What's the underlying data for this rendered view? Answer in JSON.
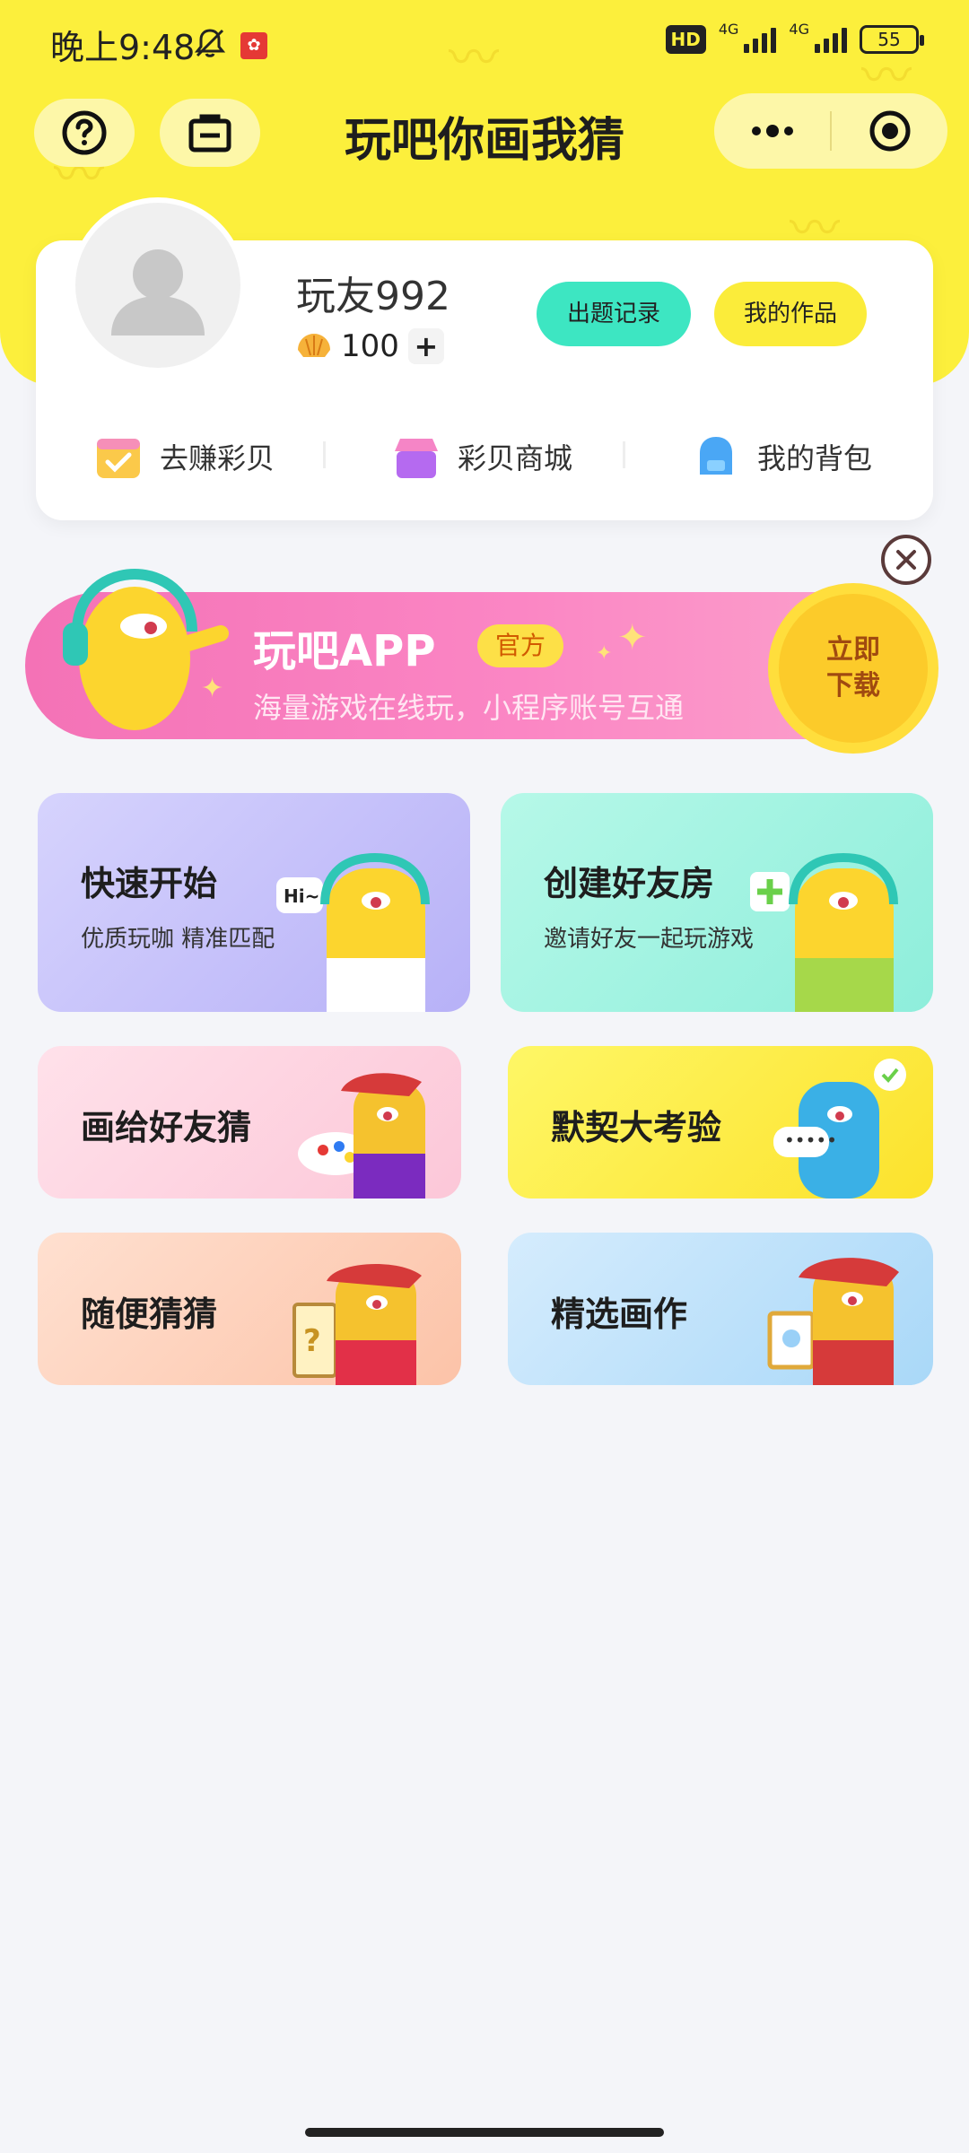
{
  "status_bar": {
    "time": "晚上9:48",
    "hd": "HD",
    "network_a": "4G",
    "network_b": "4G",
    "battery": "55"
  },
  "nav": {
    "title": "玩吧你画我猜"
  },
  "profile": {
    "username": "玩友992",
    "coins": "100",
    "plus": "+",
    "record_button": "出题记录",
    "works_button": "我的作品",
    "quick_links": [
      {
        "label": "去赚彩贝",
        "icon": "calendar-check-icon"
      },
      {
        "label": "彩贝商城",
        "icon": "shop-icon"
      },
      {
        "label": "我的背包",
        "icon": "backpack-icon"
      }
    ]
  },
  "banner": {
    "title": "玩吧APP",
    "tag": "官方",
    "subtitle": "海量游戏在线玩，小程序账号互通",
    "download_line1": "立即",
    "download_line2": "下载"
  },
  "modes": [
    {
      "title": "快速开始",
      "subtitle": "优质玩咖 精准匹配",
      "color": "#c7c3fb"
    },
    {
      "title": "创建好友房",
      "subtitle": "邀请好友一起玩游戏",
      "color": "#9ff2de"
    },
    {
      "title": "画给好友猜",
      "color": "#fdd5e1"
    },
    {
      "title": "默契大考验",
      "color": "#fcf04a"
    },
    {
      "title": "随便猜猜",
      "color": "#fdd3c0"
    },
    {
      "title": "精选画作",
      "color": "#c3e4fb"
    }
  ],
  "colors": {
    "header": "#fcef3c",
    "accent_teal": "#3de6c2",
    "accent_yellow": "#fbec3a",
    "banner_pink": "#f472b6"
  }
}
